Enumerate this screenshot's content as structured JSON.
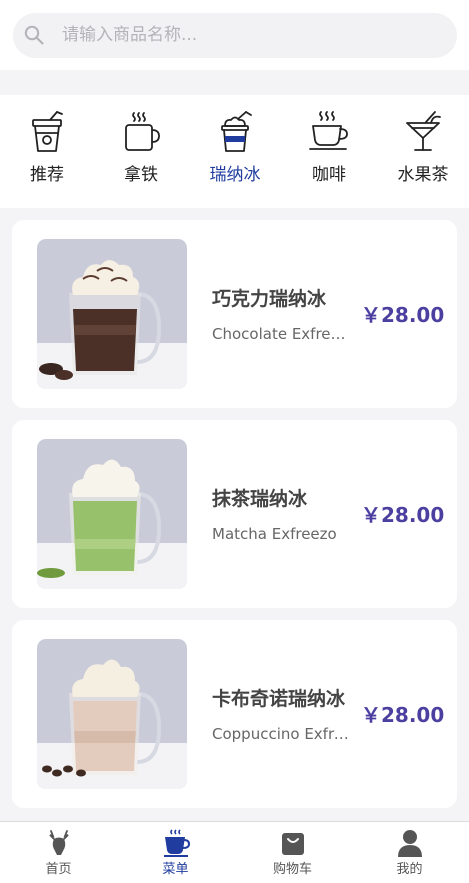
{
  "search": {
    "placeholder": "请输入商品名称..."
  },
  "categories": [
    {
      "label": "推荐",
      "icon": "takeaway-cup-icon",
      "active": false
    },
    {
      "label": "拿铁",
      "icon": "latte-mug-icon",
      "active": false
    },
    {
      "label": "瑞纳冰",
      "icon": "frappe-cup-icon",
      "active": true
    },
    {
      "label": "咖啡",
      "icon": "coffee-cup-icon",
      "active": false
    },
    {
      "label": "水果茶",
      "icon": "cocktail-glass-icon",
      "active": false
    }
  ],
  "products": [
    {
      "name": "巧克力瑞纳冰",
      "english": "Chocolate Exfreezo",
      "price": "￥28.00",
      "image": "chocolate-frappe-image"
    },
    {
      "name": "抹茶瑞纳冰",
      "english": "Matcha Exfreezo",
      "price": "￥28.00",
      "image": "matcha-frappe-image"
    },
    {
      "name": "卡布奇诺瑞纳冰",
      "english": "Coppuccino Exfreezo",
      "price": "￥28.00",
      "image": "cappuccino-frappe-image"
    }
  ],
  "tabbar": [
    {
      "label": "首页",
      "icon": "deer-home-icon",
      "active": false
    },
    {
      "label": "菜单",
      "icon": "menu-cup-icon",
      "active": true
    },
    {
      "label": "购物车",
      "icon": "shopping-bag-icon",
      "active": false
    },
    {
      "label": "我的",
      "icon": "user-icon",
      "active": false
    }
  ],
  "colors": {
    "accent": "#1f3c9e",
    "price": "#4b3fa0",
    "background": "#f4f4f6"
  }
}
